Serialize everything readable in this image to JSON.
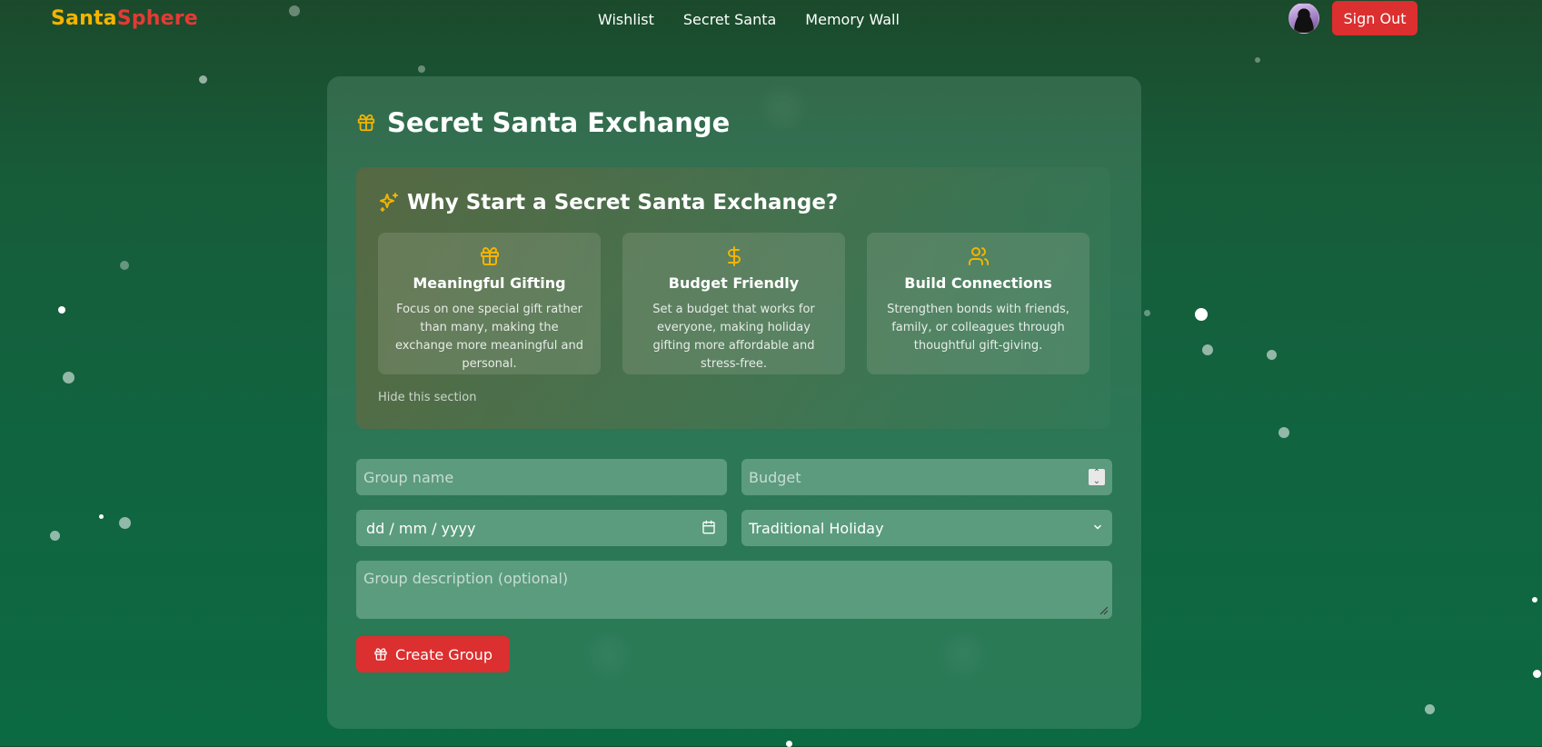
{
  "nav": {
    "logo_part1": "Santa",
    "logo_part2": "Sphere",
    "links": [
      "Wishlist",
      "Secret Santa",
      "Memory Wall"
    ],
    "sign_out": "Sign Out"
  },
  "page": {
    "title": "Secret Santa Exchange",
    "title_icon": "gift-icon"
  },
  "why": {
    "heading": "Why Start a Secret Santa Exchange?",
    "heading_icon": "sparkles-icon",
    "features": [
      {
        "icon": "gift-icon",
        "title": "Meaningful Gifting",
        "text": "Focus on one special gift rather than many, making the exchange more meaningful and personal."
      },
      {
        "icon": "dollar-icon",
        "title": "Budget Friendly",
        "text": "Set a budget that works for everyone, making holiday gifting more affordable and stress-free."
      },
      {
        "icon": "users-icon",
        "title": "Build Connections",
        "text": "Strengthen bonds with friends, family, or colleagues through thoughtful gift-giving."
      }
    ],
    "hide_label": "Hide this section"
  },
  "form": {
    "group_name_placeholder": "Group name",
    "budget_placeholder": "Budget",
    "date_placeholder": "dd / mm / yyyy",
    "theme_value": "Traditional Holiday",
    "description_placeholder": "Group description (optional)",
    "create_label": "Create Group"
  },
  "colors": {
    "accent_yellow": "#f4b400",
    "accent_red": "#dc2f2f",
    "background_green": "#106440"
  }
}
